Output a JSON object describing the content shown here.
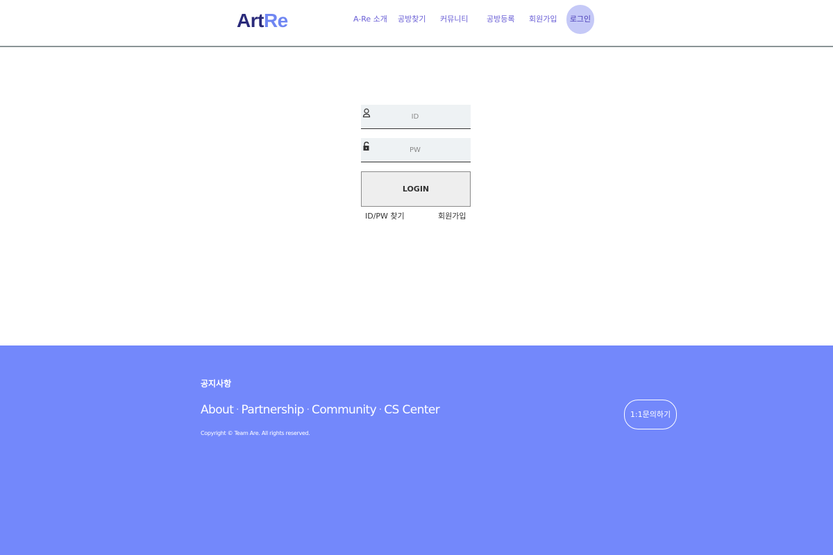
{
  "header": {
    "logo_part1": "Art",
    "logo_part2": "Re",
    "nav": [
      {
        "label": "A-Re 소개"
      },
      {
        "label": "공방찾기"
      },
      {
        "label": "커뮤니티"
      },
      {
        "label": "공방등록"
      },
      {
        "label": "회원가입"
      }
    ],
    "login_label": "로그인"
  },
  "login_form": {
    "id_placeholder": "ID",
    "pw_placeholder": "PW",
    "submit_label": "LOGIN",
    "find_label": "ID/PW 찾기",
    "signup_label": "회원가입",
    "id_icon": "user-icon",
    "pw_icon": "lock-icon"
  },
  "footer": {
    "notice_label": "공지사항",
    "links": [
      "About",
      "Partnership",
      "Community",
      "CS Center"
    ],
    "separator": "·",
    "copyright": "Copyright © Team Are. All rights reserved.",
    "inquiry_label": "1:1문의하기"
  },
  "colors": {
    "accent": "#7388fb",
    "nav_text": "#6a5fd6",
    "login_pill": "#c5c9f7",
    "logo_dark": "#2a2a7a",
    "logo_light": "#6f86f2"
  }
}
